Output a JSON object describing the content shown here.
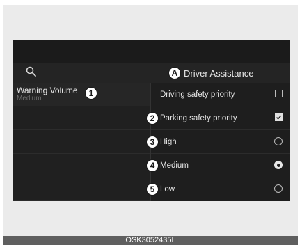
{
  "header": {
    "title": "Driver Assistance",
    "title_badge": "A",
    "search_icon": "search-icon"
  },
  "left_menu": {
    "items": [
      {
        "label": "Warning Volume",
        "value": "Medium",
        "badge": "1"
      }
    ]
  },
  "options": [
    {
      "label": "Driving safety priority",
      "badge": "",
      "control": "checkbox",
      "checked": false
    },
    {
      "label": "Parking safety priority",
      "badge": "2",
      "control": "checkbox",
      "checked": true
    },
    {
      "label": "High",
      "badge": "3",
      "control": "radio",
      "checked": false
    },
    {
      "label": "Medium",
      "badge": "4",
      "control": "radio",
      "checked": true
    },
    {
      "label": "Low",
      "badge": "5",
      "control": "radio",
      "checked": false
    }
  ],
  "footer": {
    "code": "OSK3052435L"
  },
  "colors": {
    "screen_bg": "#1e1e1e",
    "text": "#e6e6e6",
    "muted": "#6e6e6e"
  }
}
